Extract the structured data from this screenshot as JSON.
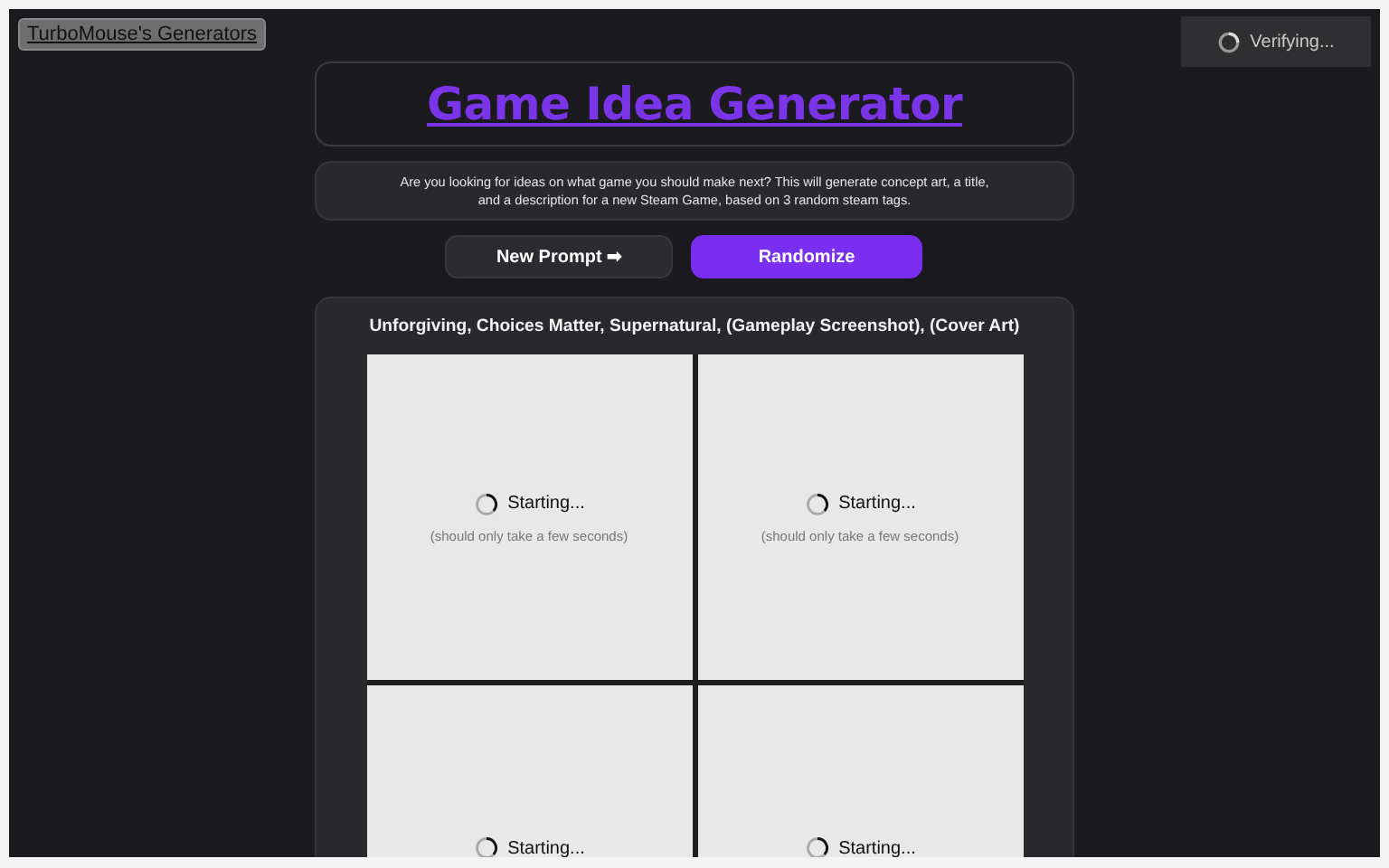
{
  "site_link": "TurboMouse's Generators",
  "verify_badge": {
    "label": "Verifying..."
  },
  "title": "Game Idea Generator",
  "description": "Are you looking for ideas on what game you should make next? This will generate concept art, a title, and a description for a new Steam Game, based on 3 random steam tags.",
  "buttons": [
    {
      "label": "New Prompt ➡",
      "kind": "secondary"
    },
    {
      "label": "Randomize",
      "kind": "primary"
    }
  ],
  "prompt": "Unforgiving, Choices Matter, Supernatural, (Gameplay Screenshot), (Cover Art)",
  "images": [
    {
      "status": "Starting...",
      "hint": "(should only take a few seconds)"
    },
    {
      "status": "Starting...",
      "hint": "(should only take a few seconds)"
    },
    {
      "status": "Starting..."
    },
    {
      "status": "Starting..."
    }
  ]
}
